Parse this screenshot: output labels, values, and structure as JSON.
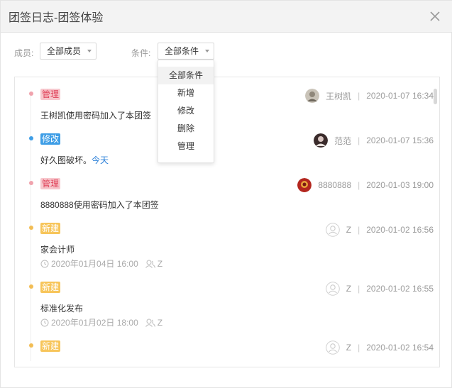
{
  "window": {
    "title": "团签日志-团签体验"
  },
  "filters": {
    "member_label": "成员:",
    "member_value": "全部成员",
    "condition_label": "条件:",
    "condition_value": "全部条件"
  },
  "dropdown": {
    "options": [
      "全部条件",
      "新增",
      "修改",
      "删除",
      "管理"
    ],
    "selected": "全部条件"
  },
  "colors": {
    "manage_tag_bg": "#f7c6cc",
    "manage_tag_fg": "#e0435a",
    "manage_dot": "#f0a3ad",
    "modify_tag_bg": "#3f9ee6",
    "modify_tag_fg": "#ffffff",
    "modify_dot": "#3f9ee6",
    "new_tag_bg": "#f7c55a",
    "new_tag_fg": "#ffffff",
    "new_dot": "#f2bd55",
    "link": "#2a7fd8"
  },
  "entries": [
    {
      "tag": "管理",
      "type": "manage",
      "content": "王树凯使用密码加入了本团签",
      "content_link": "",
      "user": "王树凯",
      "avatar": "photo-avatar-gray",
      "time": "2020-01-07 16:34"
    },
    {
      "tag": "修改",
      "type": "modify",
      "content": "好久图破坏。",
      "content_link": "今天",
      "user": "范范",
      "avatar": "photo-avatar-dark",
      "time": "2020-01-07 15:36"
    },
    {
      "tag": "管理",
      "type": "manage",
      "content": "8880888使用密码加入了本团签",
      "content_link": "",
      "user": "8880888",
      "avatar": "photo-avatar-red",
      "time": "2020-01-03 19:00"
    },
    {
      "tag": "新建",
      "type": "new",
      "content": "家会计师",
      "content_link": "",
      "user": "Z",
      "avatar": "default-user-icon",
      "time": "2020-01-02 16:56",
      "due": "2020年01月04日 16:00",
      "assignee": "Z"
    },
    {
      "tag": "新建",
      "type": "new",
      "content": "标准化发布",
      "content_link": "",
      "user": "Z",
      "avatar": "default-user-icon",
      "time": "2020-01-02 16:55",
      "due": "2020年01月02日 18:00",
      "assignee": "Z"
    },
    {
      "tag": "新建",
      "type": "new",
      "content": "",
      "content_link": "",
      "user": "Z",
      "avatar": "default-user-icon",
      "time": "2020-01-02 16:54"
    }
  ],
  "separator": "|"
}
